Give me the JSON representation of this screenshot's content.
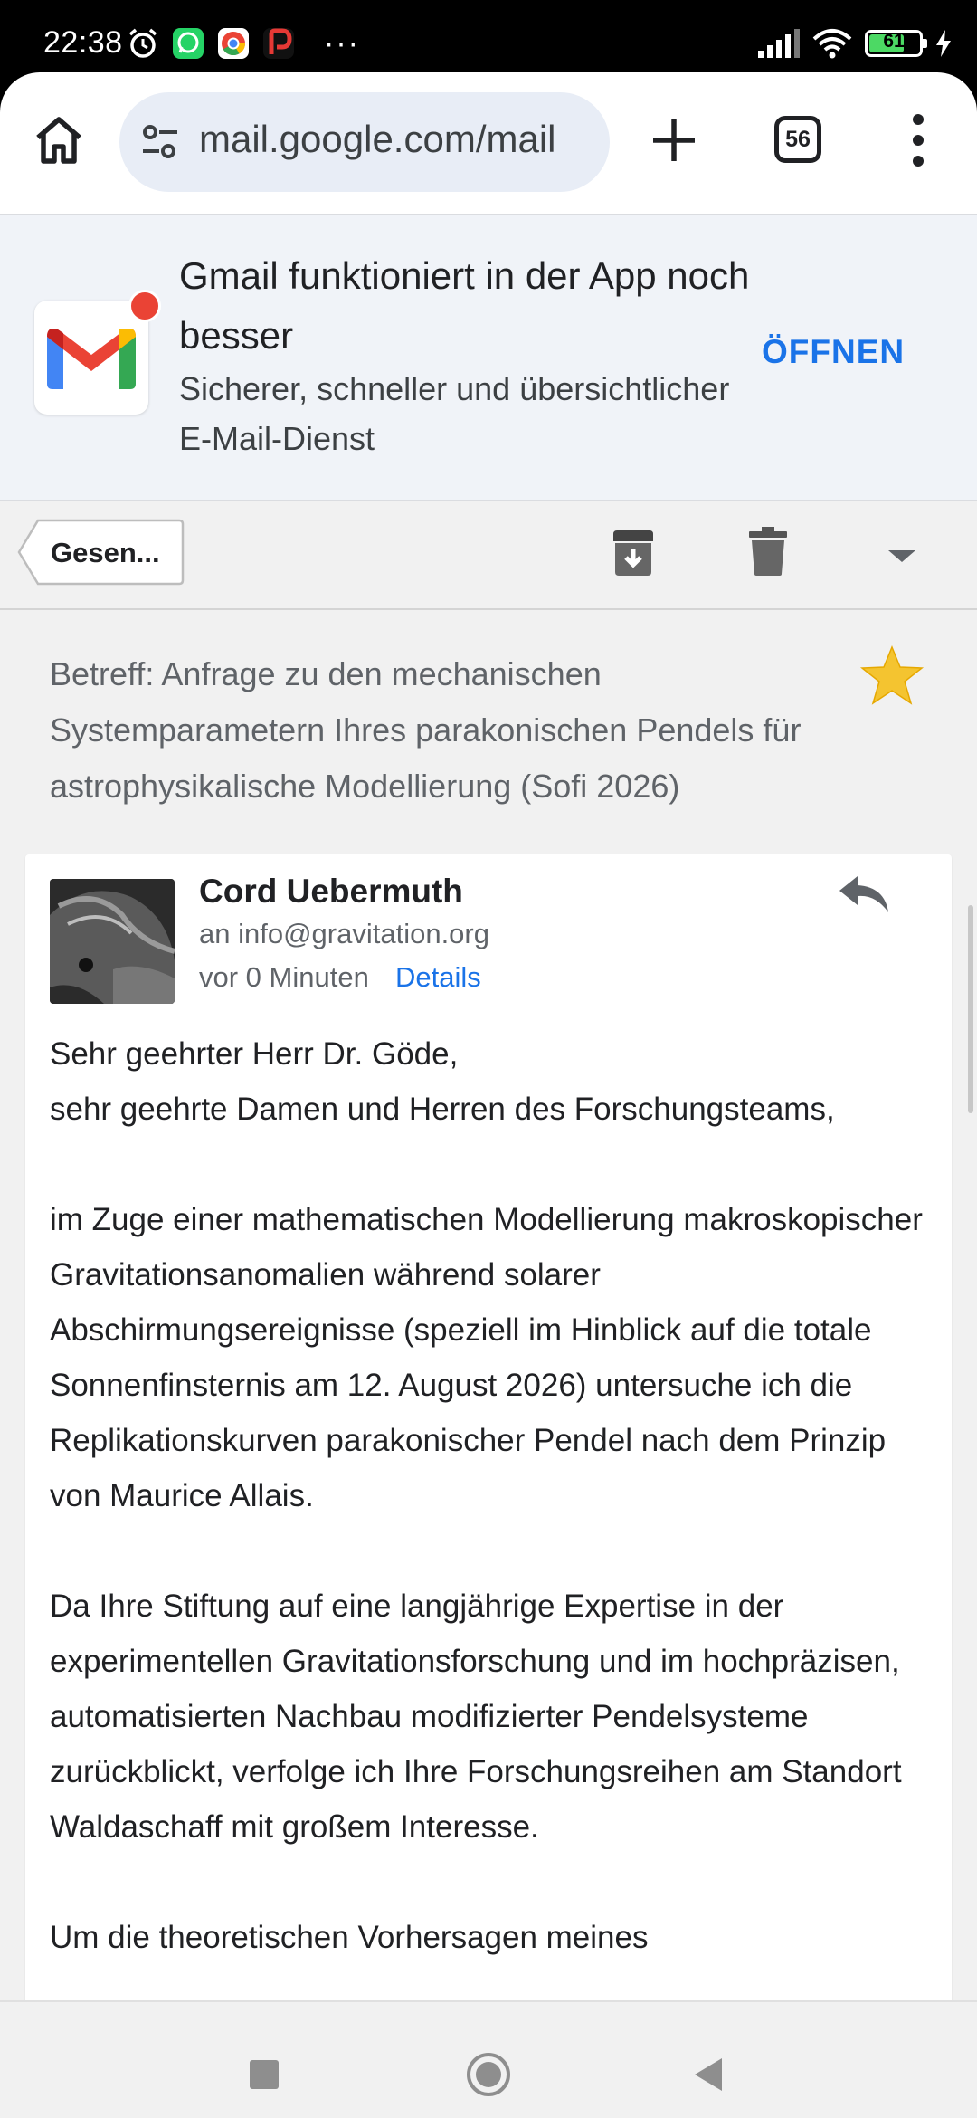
{
  "status_bar": {
    "time": "22:38",
    "battery_level": "61",
    "overflow": "···"
  },
  "browser": {
    "url": "mail.google.com/mail",
    "tab_count": "56"
  },
  "promo": {
    "title": "Gmail funktioniert in der App noch besser",
    "subtitle": "Sicherer, schneller und übersichtlicher E-Mail-Dienst",
    "open_label": "ÖFFNEN"
  },
  "toolbar": {
    "back_label": "Gesen..."
  },
  "email": {
    "subject": "Betreff: Anfrage zu den mechanischen Systemparametern Ihres parakonischen Pendels für astrophysikalische Modellierung (Sofi 2026)",
    "starred": true,
    "sender": "Cord Uebermuth",
    "recipient": "an info@gravitation.org",
    "time_ago": "vor 0 Minuten",
    "details_label": "Details",
    "body": {
      "greeting1": "Sehr geehrter Herr Dr. Göde,",
      "greeting2": "sehr geehrte Damen und Herren des Forschungsteams,",
      "para1": "im Zuge einer mathematischen Modellierung makroskopischer Gravitationsanomalien während solarer Abschirmungsereignisse (speziell im Hinblick auf die totale Sonnenfinsternis am 12. August 2026) untersuche ich die Replikationskurven parakonischer Pendel nach dem Prinzip von Maurice Allais.",
      "para2": "Da Ihre Stiftung auf eine langjährige Expertise in der experimentellen Gravitationsforschung und im hochpräzisen, automatisierten Nachbau modifizierter Pendelsysteme zurückblickt, verfolge ich Ihre Forschungsreihen am Standort Waldaschaff mit großem Interesse.",
      "para3": "Um die theoretischen Vorhersagen meines"
    }
  },
  "colors": {
    "accent": "#1a73e8",
    "star": "#f4c430",
    "promo_bg": "#f0f3f8"
  }
}
